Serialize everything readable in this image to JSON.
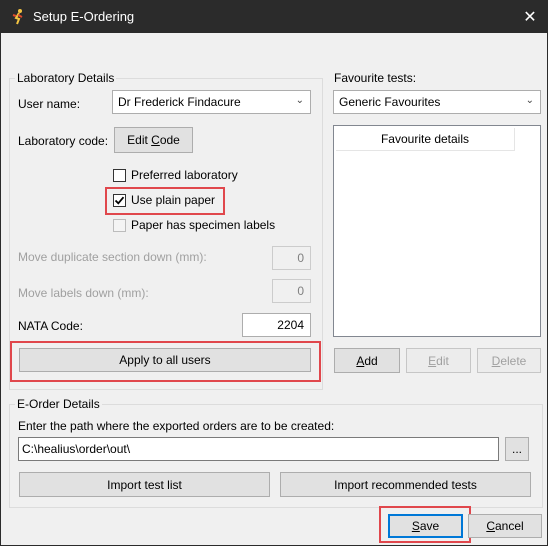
{
  "window": {
    "title": "Setup E-Ordering",
    "close_glyph": "✕"
  },
  "lab_details": {
    "legend": "Laboratory Details",
    "user_name_label": "User name:",
    "user_name_value": "Dr Frederick Findacure",
    "lab_code_label": "Laboratory code:",
    "edit_code_pre": "Edit ",
    "edit_code_ul": "C",
    "edit_code_post": "ode",
    "preferred_lab_label": "Preferred laboratory",
    "preferred_lab_checked": false,
    "plain_paper_label": "Use plain paper",
    "plain_paper_checked": true,
    "specimen_labels_label": "Paper has specimen labels",
    "specimen_labels_checked": false,
    "move_dup_label": "Move duplicate section down (mm):",
    "move_dup_value": "0",
    "move_labels_label": "Move labels down (mm):",
    "move_labels_value": "0",
    "nata_label": "NATA Code:",
    "nata_value": "2204",
    "apply_button": "Apply to all users"
  },
  "favourites": {
    "label": "Favourite tests:",
    "selected": "Generic Favourites",
    "column_header": "Favourite details",
    "add_ul": "A",
    "add_rest": "dd",
    "edit_ul": "E",
    "edit_rest": "dit",
    "delete_ul": "D",
    "delete_rest": "elete"
  },
  "eorder": {
    "legend": "E-Order Details",
    "path_prompt": "Enter the path where the exported orders are to be created:",
    "path_value": "C:\\healius\\order\\out\\",
    "browse_button": "...",
    "import_test_list": "Import test list",
    "import_recommended": "Import recommended tests"
  },
  "footer": {
    "save_ul": "S",
    "save_rest": "ave",
    "cancel_ul": "C",
    "cancel_rest": "ancel"
  },
  "colors": {
    "titlebar": "#2b2b2b",
    "highlight": "#e0474c",
    "window_bg": "#f0f0f0"
  },
  "icons": {
    "app": "runner-icon",
    "close": "close-icon",
    "dropdown": "chevron-down-icon",
    "check": "checkmark-icon"
  }
}
